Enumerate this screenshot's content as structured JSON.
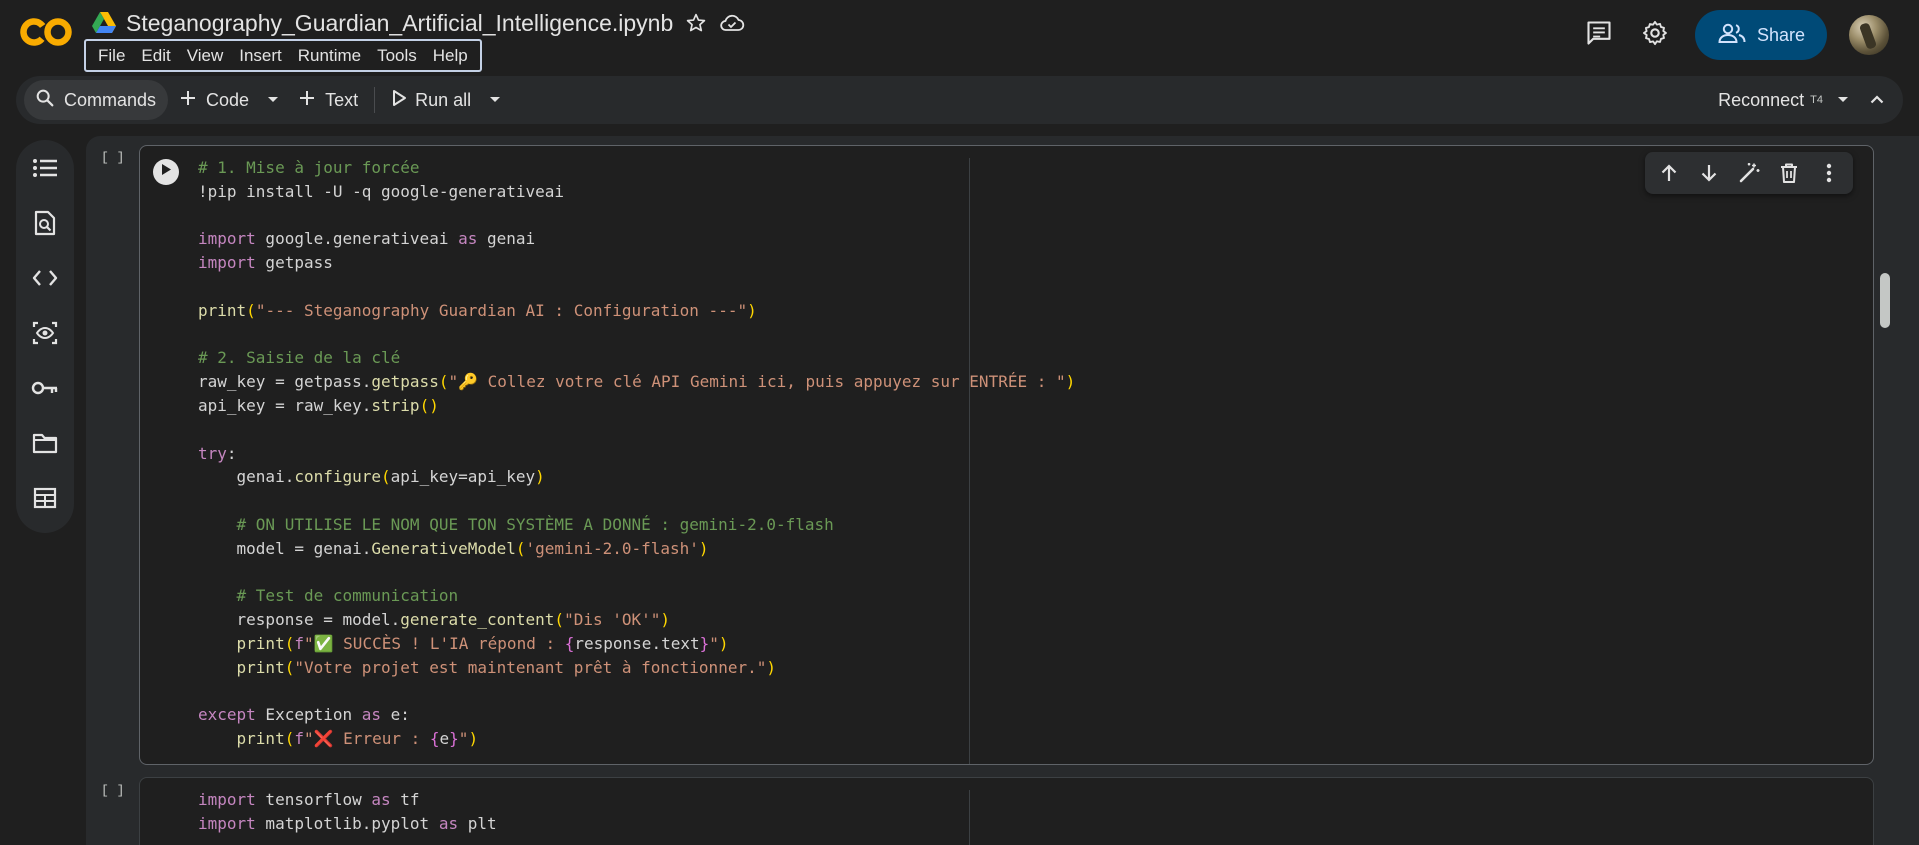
{
  "header": {
    "notebook_title": "Steganography_Guardian_Artificial_Intelligence.ipynb",
    "menu": [
      "File",
      "Edit",
      "View",
      "Insert",
      "Runtime",
      "Tools",
      "Help"
    ],
    "share_label": "Share"
  },
  "toolbar": {
    "commands_label": "Commands",
    "code_label": "Code",
    "text_label": "Text",
    "run_all_label": "Run all",
    "reconnect_label": "Reconnect",
    "runtime_type": "T4"
  },
  "cells": [
    {
      "execution_count": "[ ]",
      "lines": [
        "# 1. Mise à jour forcée",
        "!pip install -U -q google-generativeai",
        "",
        "import google.generativeai as genai",
        "import getpass",
        "",
        "print(\"--- Steganography Guardian AI : Configuration ---\")",
        "",
        "# 2. Saisie de la clé",
        "raw_key = getpass.getpass(\"🔑 Collez votre clé API Gemini ici, puis appuyez sur ENTRÉE : \")",
        "api_key = raw_key.strip()",
        "",
        "try:",
        "    genai.configure(api_key=api_key)",
        "",
        "    # ON UTILISE LE NOM QUE TON SYSTÈME A DONNÉ : gemini-2.0-flash",
        "    model = genai.GenerativeModel('gemini-2.0-flash')",
        "",
        "    # Test de communication",
        "    response = model.generate_content(\"Dis 'OK'\")",
        "    print(f\"✅ SUCCÈS ! L'IA répond : {response.text}\")",
        "    print(\"Votre projet est maintenant prêt à fonctionner.\")",
        "",
        "except Exception as e:",
        "    print(f\"❌ Erreur : {e}\")"
      ]
    },
    {
      "execution_count": "[ ]",
      "lines": [
        "import tensorflow as tf",
        "import matplotlib.pyplot as plt"
      ]
    }
  ],
  "colors": {
    "background": "#1f1f1f",
    "surface": "#282a2c",
    "share_button": "#004a77",
    "keyword": "#c586c0",
    "string": "#ce9178",
    "comment": "#6a9955",
    "function": "#dcdcaa"
  },
  "icons": {
    "rail": [
      "toc-icon",
      "find-replace-icon",
      "code-snippets-icon",
      "variables-icon",
      "secrets-key-icon",
      "files-folder-icon",
      "data-table-icon"
    ],
    "cell_toolbar": [
      "move-up-icon",
      "move-down-icon",
      "edit-magic-icon",
      "delete-icon",
      "more-icon"
    ]
  }
}
